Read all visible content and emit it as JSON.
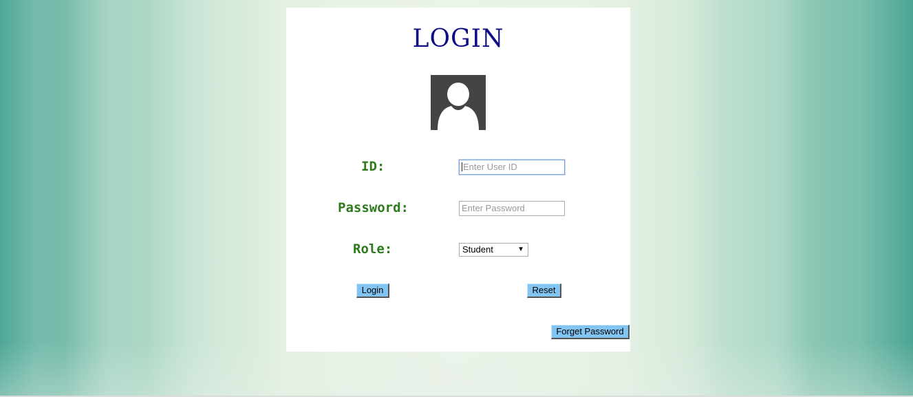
{
  "login": {
    "title": "LOGIN",
    "avatar_icon": "user-silhouette-icon",
    "id_label": "ID:",
    "id_placeholder": "Enter User ID",
    "password_label": "Password:",
    "password_placeholder": "Enter Password",
    "role_label": "Role:",
    "role_selected": "Student",
    "role_dropdown_icon": "triangle-down-icon",
    "login_button": "Login",
    "reset_button": "Reset",
    "forget_password_button": "Forget Password"
  },
  "colors": {
    "title": "#0c0c86",
    "labels": "#2d7a1a",
    "buttons": "#82c5f2",
    "avatar_bg": "#444444"
  }
}
